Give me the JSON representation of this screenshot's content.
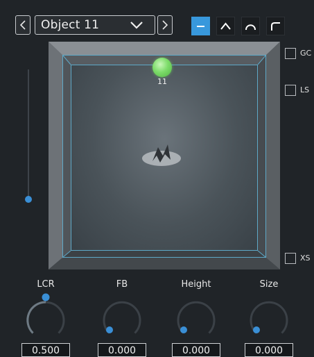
{
  "toolbar": {
    "prev_icon": "chevron-left-icon",
    "next_icon": "chevron-right-icon",
    "object_selected": "Object 11",
    "dropdown_icon": "chevron-down-icon",
    "shape_buttons": [
      {
        "icon": "flat-line-icon",
        "active": true
      },
      {
        "icon": "peak-icon",
        "active": false
      },
      {
        "icon": "dome-icon",
        "active": false
      },
      {
        "icon": "corner-icon",
        "active": false
      }
    ],
    "accent_color": "#3898dc"
  },
  "elevation_slider": {
    "value": 0.0
  },
  "pan_area": {
    "object_label": "11",
    "object_color": "#7ddc6a",
    "logo_icon": "brand-logo-icon"
  },
  "options": {
    "gc": "GC",
    "ls": "LS",
    "xs": "XS"
  },
  "knobs": [
    {
      "label": "LCR",
      "value": "0.500"
    },
    {
      "label": "FB",
      "value": "0.000"
    },
    {
      "label": "Height",
      "value": "0.000"
    },
    {
      "label": "Size",
      "value": "0.000"
    }
  ]
}
